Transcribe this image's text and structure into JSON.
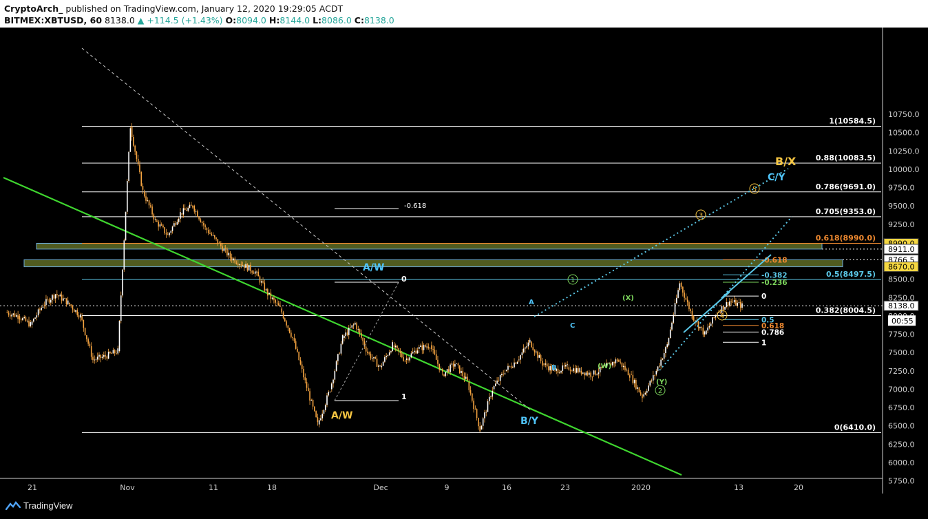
{
  "header": {
    "author": "CryptoArch_",
    "published": "published on TradingView.com, January 12, 2020 19:29:05 ACDT",
    "symbol": "BITMEX:XBTUSD, 60",
    "last": "8138.0",
    "change": "▲ +114.5 (+1.43%)",
    "o_label": "O:",
    "o_value": "8094.0",
    "h_label": "H:",
    "h_value": "8144.0",
    "l_label": "L:",
    "l_value": "8086.0",
    "c_label": "C:",
    "c_value": "8138.0"
  },
  "footer": {
    "brand": "TradingView"
  },
  "colors": {
    "background": "#000000",
    "candles": "#f7a541",
    "trendline": "#3fd62f",
    "cyan": "#5bc8e8",
    "fib_orange": "#f08a30",
    "fib_green": "#7bd35b",
    "zone_fill": "#6b7a2a",
    "label_yellow": "#f5c542",
    "label_cyan": "#4fc3f7"
  },
  "chart_data": {
    "type": "candlestick",
    "ylim": [
      5600,
      10800
    ],
    "price_ticks": [
      "5750.0",
      "6000.0",
      "6250.0",
      "6500.0",
      "6750.0",
      "7000.0",
      "7250.0",
      "7500.0",
      "7750.0",
      "8000.0",
      "8250.0",
      "8500.0",
      "9000.0",
      "9250.0",
      "9500.0",
      "9750.0",
      "10000.0",
      "10250.0",
      "10500.0",
      "10750.0"
    ],
    "date_ticks": [
      "21",
      "Nov",
      "11",
      "18",
      "Dec",
      "9",
      "16",
      "23",
      "2020",
      "13",
      "20"
    ],
    "price_path": [
      [
        8050,
        8000,
        7880,
        8150,
        8300,
        8180,
        8000,
        7400,
        7450,
        7520,
        10584,
        9700,
        9300,
        9100,
        9400,
        9500,
        9200,
        9000,
        8800,
        8700,
        8600,
        8300,
        8100,
        7700,
        7100,
        6520,
        7000,
        7700,
        7900,
        7500,
        7300,
        7600,
        7400,
        7550,
        7600,
        7200,
        7350,
        7100,
        6450,
        7000,
        7250,
        7400,
        7650,
        7350,
        7250,
        7300,
        7250,
        7200,
        7300,
        7400,
        7200,
        6900,
        7200,
        7600,
        8450,
        8000,
        7750,
        8050,
        8200,
        8138
      ]
    ],
    "fib_levels": [
      {
        "label": "1(10584.5)",
        "value": 10584.5
      },
      {
        "label": "0.88(10083.5)",
        "value": 10083.5
      },
      {
        "label": "0.786(9691.0)",
        "value": 9691.0
      },
      {
        "label": "0.705(9353.0)",
        "value": 9353.0
      },
      {
        "label": "0.618(8990.0)",
        "value": 8990.0
      },
      {
        "label": "0.5(8497.5)",
        "value": 8497.5
      },
      {
        "label": "0.382(8004.5)",
        "value": 8004.5
      },
      {
        "label": "0(6410.0)",
        "value": 6410.0
      }
    ],
    "small_fib_labels": [
      "0",
      "1",
      "-0.618",
      "-0.618",
      "-0.382",
      "-0.236",
      "0",
      "0.5",
      "0.618",
      "0.786",
      "1"
    ],
    "wave_labels": [
      "A/W",
      "A/W",
      "B/Y",
      "B/X",
      "C/Y",
      "A",
      "B",
      "C",
      "(W)",
      "(X)",
      "(Y)"
    ],
    "circled_wave_labels": [
      "1",
      "2",
      "3",
      "4",
      "5"
    ],
    "axis_tags": [
      {
        "label": "8990.0",
        "value": 8990.0
      },
      {
        "label": "8911.0",
        "value": 8911.0
      },
      {
        "label": "8766.5",
        "value": 8766.5
      },
      {
        "label": "8670.0",
        "value": 8670.0
      },
      {
        "label": "8138.0",
        "value": 8138.0
      }
    ],
    "countdown": "00:55",
    "zones": [
      {
        "from": 8911,
        "to": 8990
      },
      {
        "from": 8670,
        "to": 8766.5
      }
    ]
  }
}
